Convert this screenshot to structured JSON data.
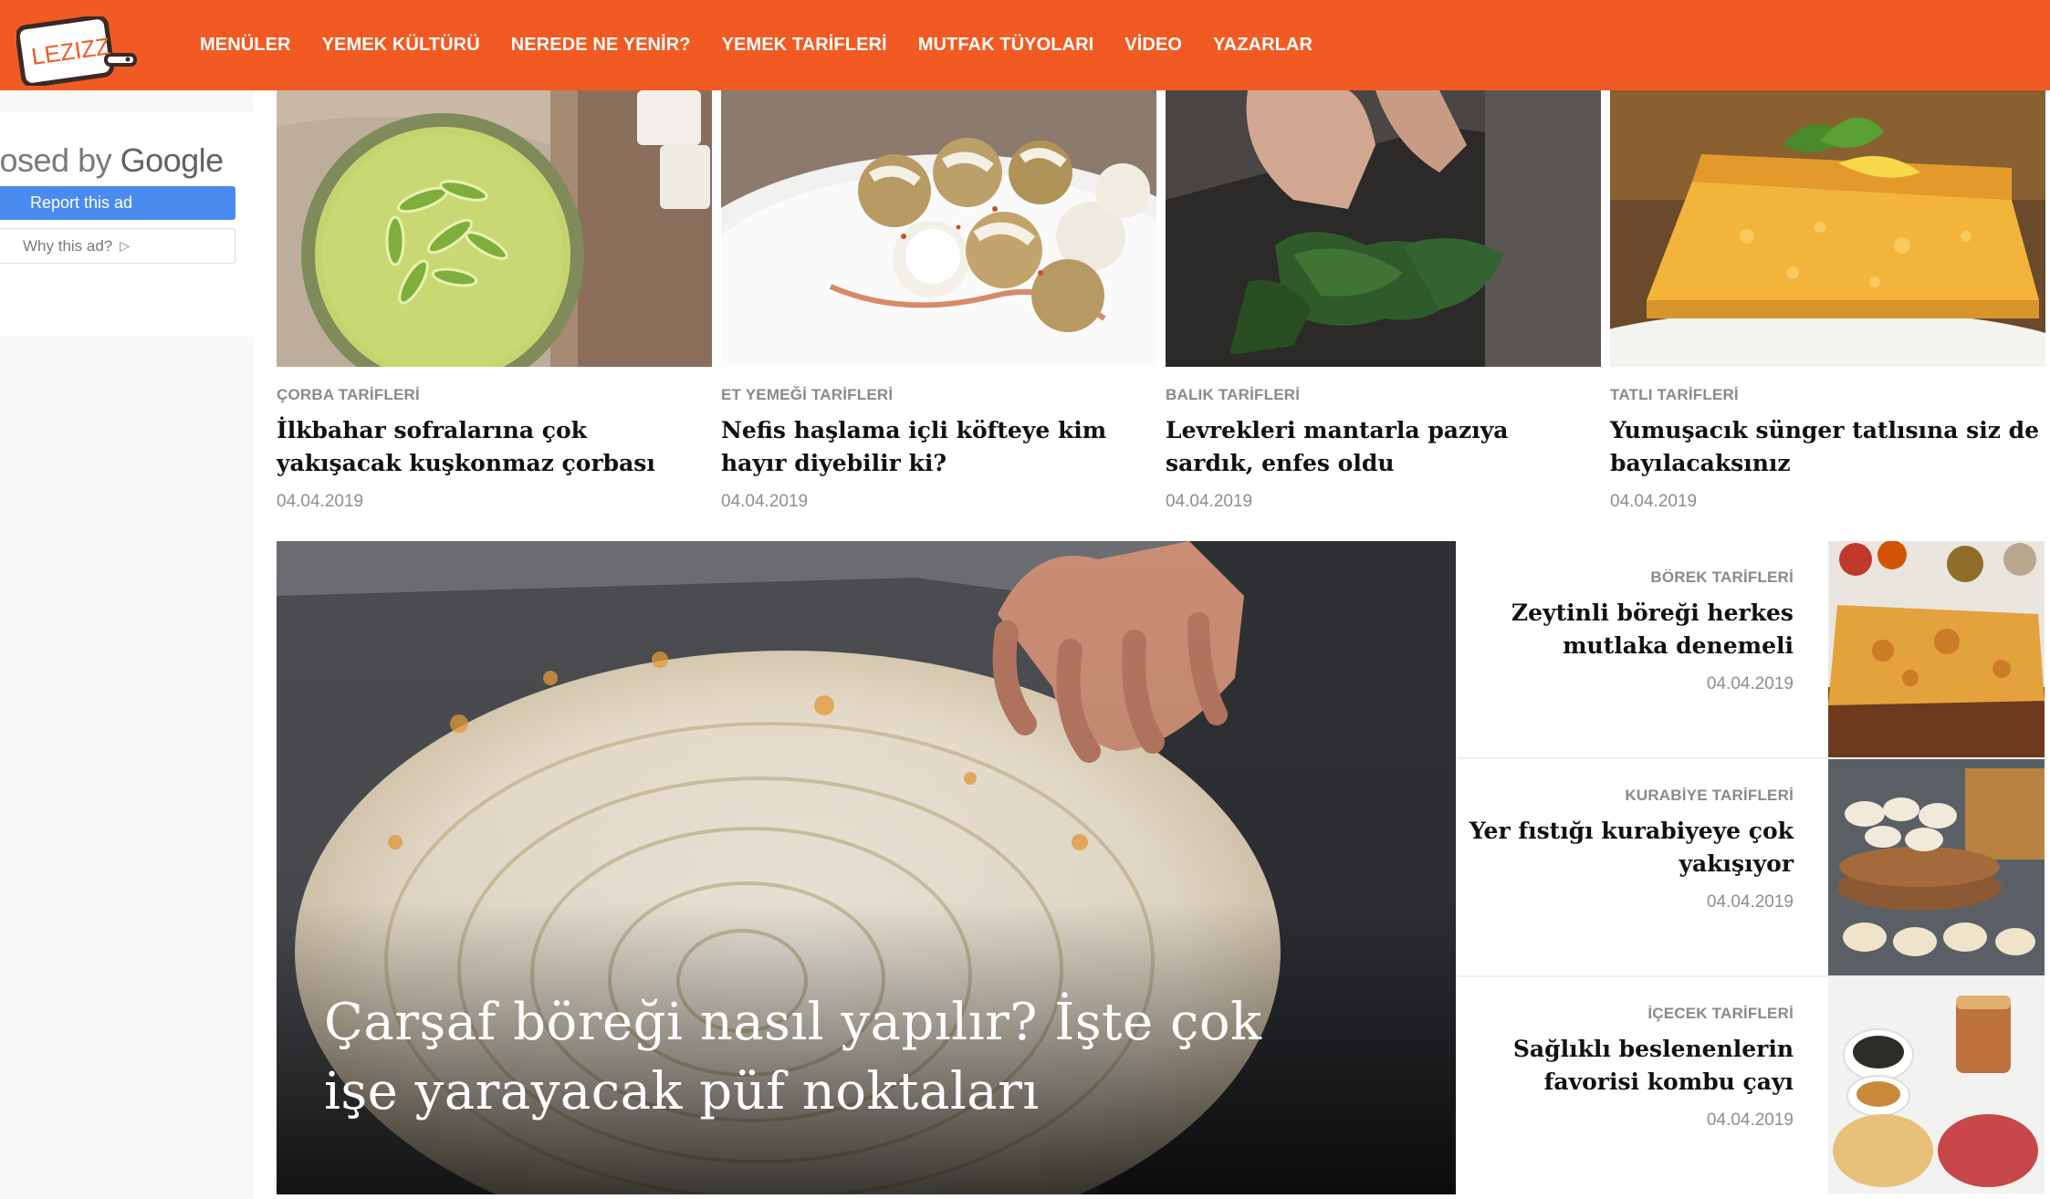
{
  "brand": {
    "logo_text": "LEZIZZ"
  },
  "nav": {
    "items": [
      "MENÜLER",
      "YEMEK KÜLTÜRÜ",
      "NEREDE NE YENİR?",
      "YEMEK TARİFLERİ",
      "MUTFAK TÜYOLARI",
      "VİDEO",
      "YAZARLAR"
    ]
  },
  "ad": {
    "closed_prefix": "losed by ",
    "closed_brand": "Google",
    "report_label": "Report this ad",
    "why_label": "Why this ad?",
    "why_icon": "play-triangle-icon"
  },
  "cards": [
    {
      "category": "ÇORBA TARİFLERİ",
      "title": "İlkbahar sofralarına çok yakışacak kuşkonmaz çorbası",
      "date": "04.04.2019"
    },
    {
      "category": "ET YEMEĞİ TARİFLERİ",
      "title": "Nefis haşlama içli köfteye kim hayır diyebilir ki?",
      "date": "04.04.2019"
    },
    {
      "category": "BALIK TARİFLERİ",
      "title": "Levrekleri mantarla pazıya sardık, enfes oldu",
      "date": "04.04.2019"
    },
    {
      "category": "TATLI TARİFLERİ",
      "title": "Yumuşacık sünger tatlısına siz de bayılacaksınız",
      "date": "04.04.2019"
    }
  ],
  "hero": {
    "title": "Çarşaf böreği nasıl yapılır? İşte çok işe yarayacak püf noktaları"
  },
  "side": [
    {
      "category": "BÖREK TARİFLERİ",
      "title": "Zeytinli böreği herkes mutlaka denemeli",
      "date": "04.04.2019"
    },
    {
      "category": "KURABİYE TARİFLERİ",
      "title": "Yer fıstığı kurabiyeye çok yakışıyor",
      "date": "04.04.2019"
    },
    {
      "category": "İÇECEK TARİFLERİ",
      "title": "Sağlıklı beslenenlerin favorisi kombu çayı",
      "date": "04.04.2019"
    }
  ],
  "colors": {
    "brand_orange": "#f15a22",
    "ad_blue": "#4b8bf0"
  }
}
